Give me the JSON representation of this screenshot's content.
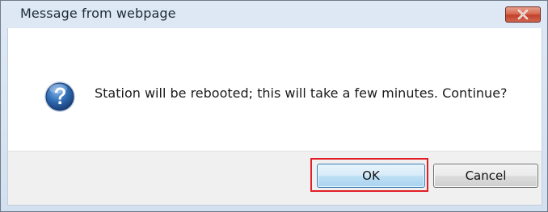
{
  "dialog": {
    "title": "Message from webpage",
    "message": "Station will be rebooted; this will take a few minutes. Continue?",
    "icon": "question-icon",
    "close_icon": "close-icon",
    "buttons": {
      "ok_label": "OK",
      "cancel_label": "Cancel"
    },
    "highlighted_button": "OK"
  },
  "colors": {
    "highlight": "#e21e26",
    "close_button": "#c2412a",
    "question_icon": "#2f6cb3"
  }
}
